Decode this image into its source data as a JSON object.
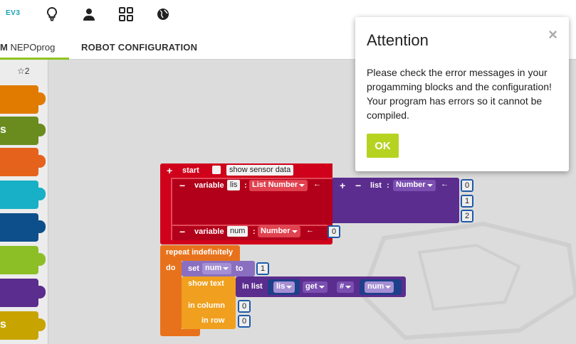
{
  "header": {
    "robot_label": "EV3"
  },
  "tabs": {
    "program_prefix": "M",
    "program_name": "NEPOprog",
    "config": "ROBOT CONFIGURATION"
  },
  "sidebar": {
    "star_count": "☆2",
    "labels": [
      "s",
      "s"
    ]
  },
  "blocks": {
    "start": {
      "plus": "+",
      "label": "start",
      "checkbox_label": "show sensor data"
    },
    "var_lis": {
      "minus": "−",
      "label": "variable",
      "name": "lis",
      "colon": ":",
      "type": "List Number",
      "arrow": "←"
    },
    "list_create": {
      "plus": "+",
      "minus": "−",
      "label": "list",
      "colon": ":",
      "type": "Number",
      "arrow": "←",
      "values": [
        "0",
        "1",
        "2"
      ]
    },
    "var_num": {
      "minus": "−",
      "label": "variable",
      "name": "num",
      "colon": ":",
      "type": "Number",
      "arrow": "←",
      "value": "0"
    },
    "repeat": {
      "label": "repeat indefinitely",
      "do": "do"
    },
    "set": {
      "label": "set",
      "var": "num",
      "to": "to",
      "value": "1"
    },
    "show_text": {
      "label": "show text",
      "column_label": "in column",
      "column_value": "0",
      "row_label": "in row",
      "row_value": "0"
    },
    "list_get": {
      "label": "in list",
      "list": "lis",
      "op": "get",
      "mode": "#",
      "index_var": "num"
    }
  },
  "modal": {
    "title": "Attention",
    "close": "×",
    "message": "Please check the error messages in your progamming blocks and the configuration! Your program has errors so it cannot be compiled.",
    "ok": "OK"
  },
  "colors": {
    "accent": "#8fc31f",
    "ok_button": "#b6d321",
    "start_block": "#d0021b",
    "list_block": "#5b2d8e",
    "control_block": "#e8721c",
    "action_block": "#f0a01e",
    "number_block": "#1e5aa8"
  }
}
